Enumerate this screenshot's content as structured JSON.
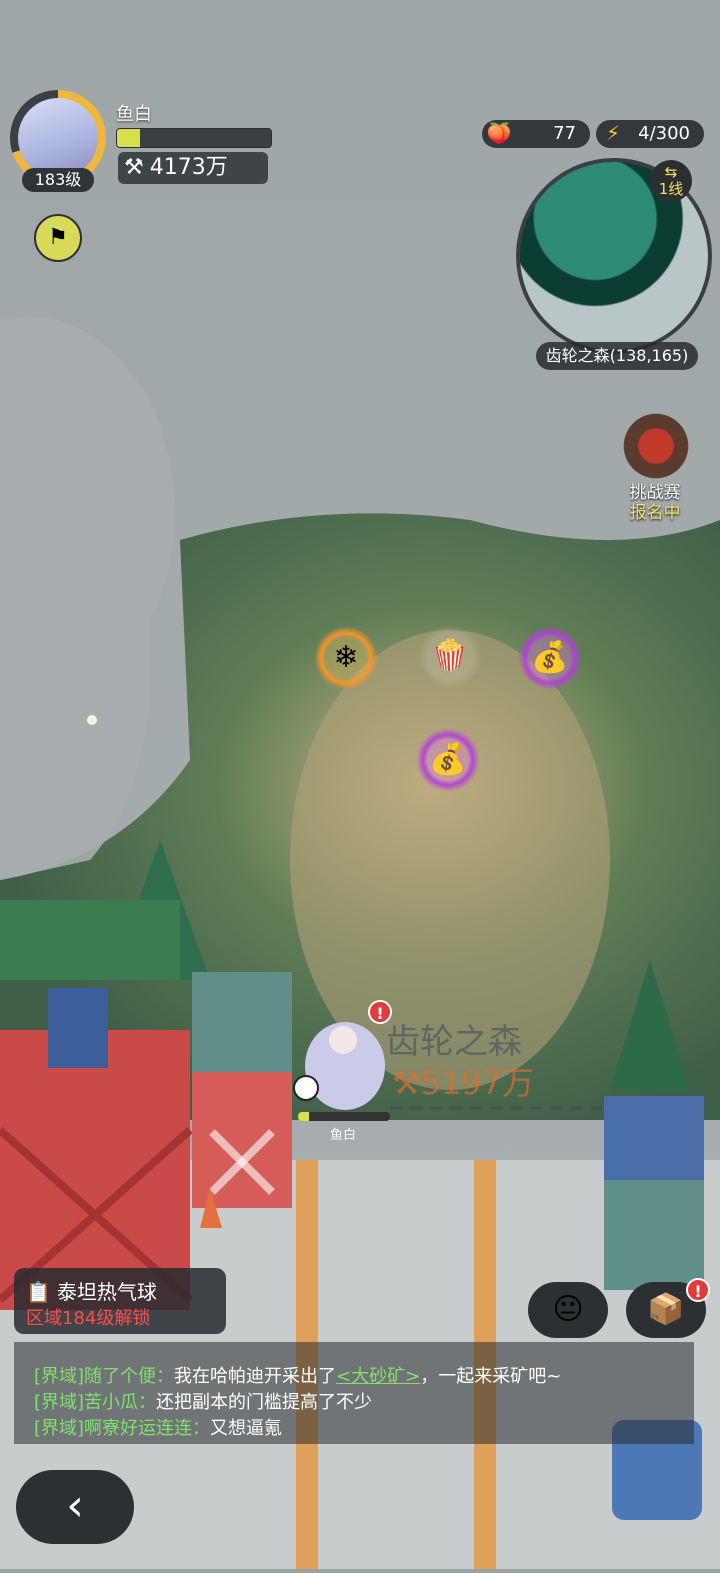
{
  "player": {
    "name": "鱼白",
    "level": "183级",
    "exp_fraction": 0.15,
    "power": "4173万"
  },
  "resources": {
    "apple": "77",
    "energy": "4/300"
  },
  "minimap": {
    "line": "1线",
    "location": "齿轮之森(138,165)"
  },
  "event": {
    "title": "挑战赛",
    "subtitle": "报名中"
  },
  "world": {
    "zone_name": "齿轮之森",
    "zone_power": "5197万",
    "character_name": "鱼白"
  },
  "quest": {
    "title": "泰坦热气球",
    "requirement": "区域184级解锁"
  },
  "chat": [
    {
      "channel": "[界域]",
      "name": "随了个便：",
      "text": "我在哈帕迪开采出了",
      "link": "<大砂矿>",
      "tail": "，一起来采矿吧~"
    },
    {
      "channel": "[界域]",
      "name": "苦小瓜：",
      "text": "还把副本的门槛提高了不少",
      "link": "",
      "tail": ""
    },
    {
      "channel": "[界域]",
      "name": "啊寮好运连连：",
      "text": "又想逼氪",
      "link": "",
      "tail": ""
    }
  ],
  "icons": {
    "power": "crossed-tools-icon",
    "apple": "apple-icon",
    "energy": "lightning-icon",
    "flag": "flag-icon",
    "back": "chevron-left-icon",
    "emote": "emoji-face-icon",
    "box": "cube-box-icon",
    "quest": "clipboard-icon"
  },
  "colors": {
    "accent_yellow": "#d6e04a",
    "alert_red": "#e23b3b",
    "chat_green": "#7fe26a",
    "unlock_red": "#ff4b4b"
  }
}
